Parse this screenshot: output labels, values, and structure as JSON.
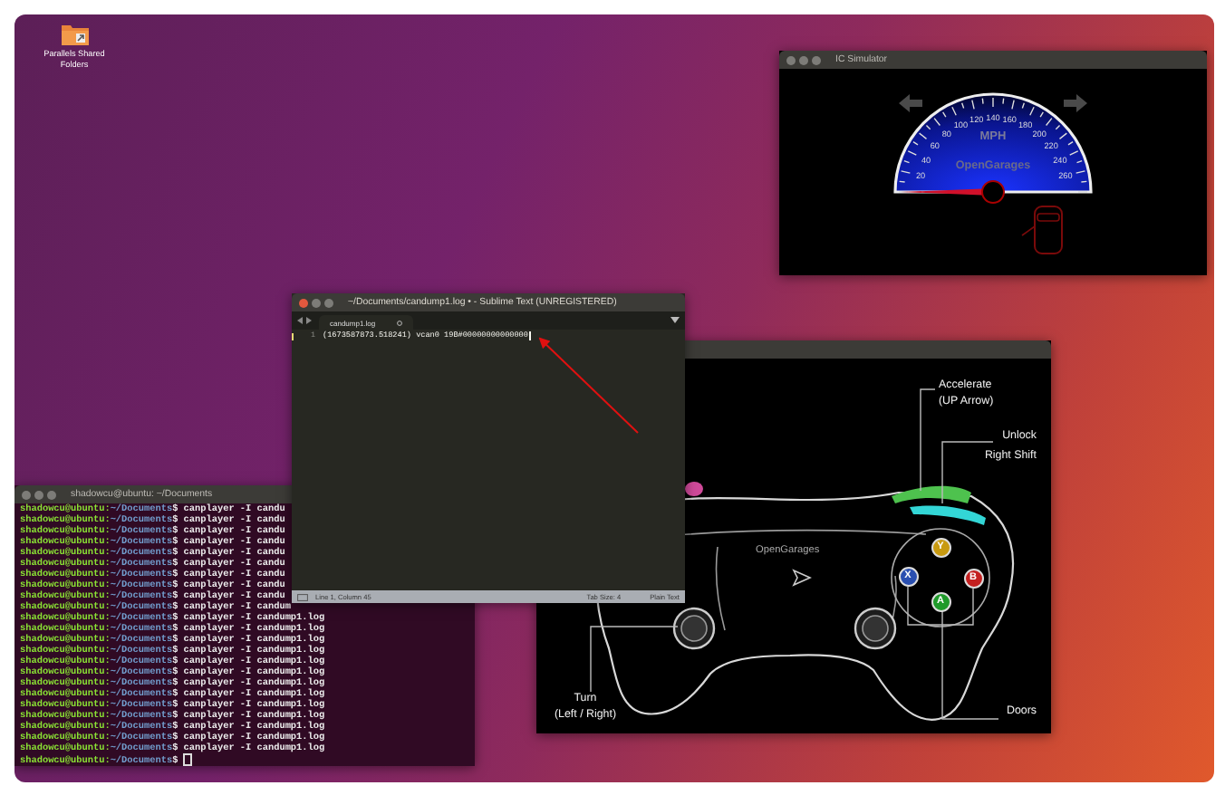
{
  "desktop_icons": [
    {
      "label": "Parallels Shared Folders"
    }
  ],
  "ic_simulator": {
    "title": "IC Simulator",
    "focused": false,
    "turn_signals": [
      {
        "on": false
      },
      {
        "on": false
      }
    ],
    "speedometer": {
      "unit": "MPH",
      "brand": "OpenGarages",
      "tick_labels": [
        "20",
        "40",
        "60",
        "80",
        "100",
        "120",
        "140",
        "160",
        "180",
        "200",
        "220",
        "240",
        "260"
      ]
    },
    "door_open": true
  },
  "gamepad_window": {
    "brand": "OpenGarages",
    "labels": [
      {
        "kind": "accelerate",
        "lines": [
          "Accelerate",
          "(UP Arrow)"
        ]
      },
      {
        "kind": "unlock",
        "lines": [
          "Unlock"
        ]
      },
      {
        "kind": "right_shift",
        "lines": [
          "Right Shift"
        ]
      },
      {
        "kind": "turn",
        "lines": [
          "Turn",
          "(Left / Right)"
        ]
      },
      {
        "kind": "doors",
        "lines": [
          "Doors"
        ]
      }
    ],
    "face_buttons": [
      {
        "kind": "top",
        "label": "Y",
        "color": "#c89a10"
      },
      {
        "kind": "left",
        "label": "X",
        "color": "#2a4fb0"
      },
      {
        "kind": "right",
        "label": "B",
        "color": "#c42020"
      },
      {
        "kind": "bottom",
        "label": "A",
        "color": "#1f9a2a"
      }
    ]
  },
  "terminal": {
    "title": "shadowcu@ubuntu: ~/Documents",
    "focused": false,
    "lines": [
      {
        "user": "shadowcu@ubuntu:",
        "path": "~/Documents",
        "command": "$ canplayer -I candu",
        "cursor": false
      },
      {
        "user": "shadowcu@ubuntu:",
        "path": "~/Documents",
        "command": "$ canplayer -I candu",
        "cursor": false
      },
      {
        "user": "shadowcu@ubuntu:",
        "path": "~/Documents",
        "command": "$ canplayer -I candu",
        "cursor": false
      },
      {
        "user": "shadowcu@ubuntu:",
        "path": "~/Documents",
        "command": "$ canplayer -I candu",
        "cursor": false
      },
      {
        "user": "shadowcu@ubuntu:",
        "path": "~/Documents",
        "command": "$ canplayer -I candu",
        "cursor": false
      },
      {
        "user": "shadowcu@ubuntu:",
        "path": "~/Documents",
        "command": "$ canplayer -I candu",
        "cursor": false
      },
      {
        "user": "shadowcu@ubuntu:",
        "path": "~/Documents",
        "command": "$ canplayer -I candu",
        "cursor": false
      },
      {
        "user": "shadowcu@ubuntu:",
        "path": "~/Documents",
        "command": "$ canplayer -I candu",
        "cursor": false
      },
      {
        "user": "shadowcu@ubuntu:",
        "path": "~/Documents",
        "command": "$ canplayer -I candu",
        "cursor": false
      },
      {
        "user": "shadowcu@ubuntu:",
        "path": "~/Documents",
        "command": "$ canplayer -I candum",
        "cursor": false
      },
      {
        "user": "shadowcu@ubuntu:",
        "path": "~/Documents",
        "command": "$ canplayer -I candump1.log",
        "cursor": false
      },
      {
        "user": "shadowcu@ubuntu:",
        "path": "~/Documents",
        "command": "$ canplayer -I candump1.log",
        "cursor": false
      },
      {
        "user": "shadowcu@ubuntu:",
        "path": "~/Documents",
        "command": "$ canplayer -I candump1.log",
        "cursor": false
      },
      {
        "user": "shadowcu@ubuntu:",
        "path": "~/Documents",
        "command": "$ canplayer -I candump1.log",
        "cursor": false
      },
      {
        "user": "shadowcu@ubuntu:",
        "path": "~/Documents",
        "command": "$ canplayer -I candump1.log",
        "cursor": false
      },
      {
        "user": "shadowcu@ubuntu:",
        "path": "~/Documents",
        "command": "$ canplayer -I candump1.log",
        "cursor": false
      },
      {
        "user": "shadowcu@ubuntu:",
        "path": "~/Documents",
        "command": "$ canplayer -I candump1.log",
        "cursor": false
      },
      {
        "user": "shadowcu@ubuntu:",
        "path": "~/Documents",
        "command": "$ canplayer -I candump1.log",
        "cursor": false
      },
      {
        "user": "shadowcu@ubuntu:",
        "path": "~/Documents",
        "command": "$ canplayer -I candump1.log",
        "cursor": false
      },
      {
        "user": "shadowcu@ubuntu:",
        "path": "~/Documents",
        "command": "$ canplayer -I candump1.log",
        "cursor": false
      },
      {
        "user": "shadowcu@ubuntu:",
        "path": "~/Documents",
        "command": "$ canplayer -I candump1.log",
        "cursor": false
      },
      {
        "user": "shadowcu@ubuntu:",
        "path": "~/Documents",
        "command": "$ canplayer -I candump1.log",
        "cursor": false
      },
      {
        "user": "shadowcu@ubuntu:",
        "path": "~/Documents",
        "command": "$ canplayer -I candump1.log",
        "cursor": false
      },
      {
        "user": "shadowcu@ubuntu:",
        "path": "~/Documents",
        "command": "$",
        "cursor": true
      }
    ]
  },
  "editor": {
    "title": "~/Documents/candump1.log • - Sublime Text (UNREGISTERED)",
    "focused": true,
    "tabs": [
      {
        "label": "candump1.log",
        "selected": true,
        "modified": true
      }
    ],
    "lines": [
      {
        "number": "1",
        "text": "(1673587873.518241) vcan0 19B#00000000000000",
        "cursor": true
      }
    ],
    "status": {
      "position": "Line 1, Column 45",
      "tab_size": "Tab Size: 4",
      "syntax": "Plain Text"
    }
  }
}
